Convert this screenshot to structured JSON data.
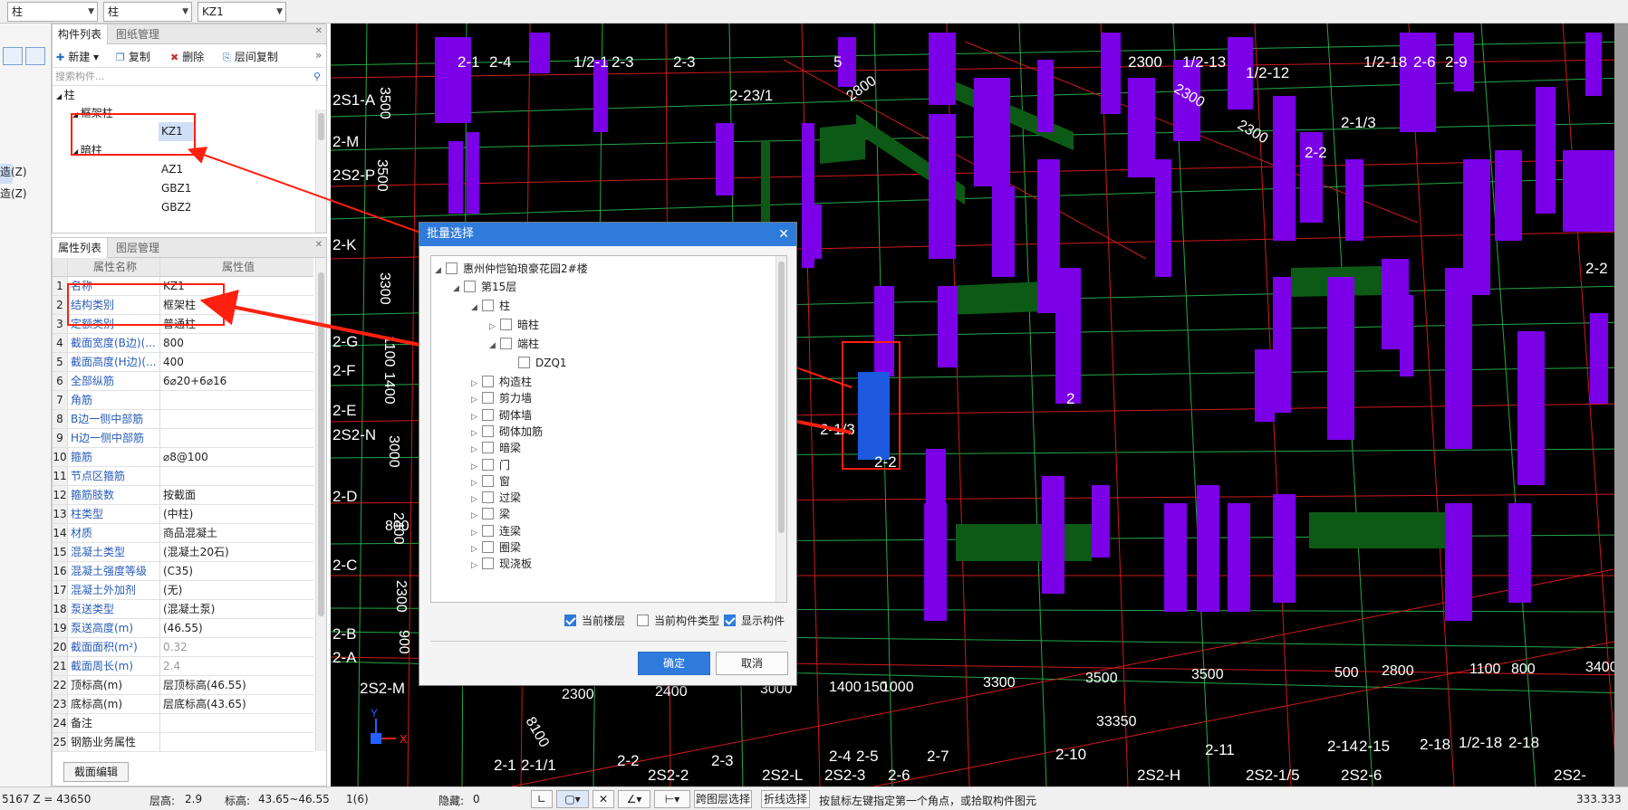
{
  "combos": {
    "c1": "柱",
    "c2": "柱",
    "c3": "KZ1"
  },
  "left_strip": {
    "items": [
      "造(Z)",
      "造(Z)"
    ]
  },
  "component_panel": {
    "tabs": [
      "构件列表",
      "图纸管理"
    ],
    "toolbar": {
      "new": "新建",
      "copy": "复制",
      "delete": "删除",
      "floor_copy": "层间复制"
    },
    "search_placeholder": "搜索构件...",
    "tree": {
      "root": "柱",
      "frame_col": "框架柱",
      "kz1": "KZ1",
      "hidden_col": "暗柱",
      "az1": "AZ1",
      "gbz1": "GBZ1",
      "gbz2": "GBZ2"
    }
  },
  "property_panel": {
    "tabs": [
      "属性列表",
      "图层管理"
    ],
    "headers": {
      "name": "属性名称",
      "value": "属性值"
    },
    "rows": [
      {
        "n": "1",
        "name": "名称",
        "value": "KZ1"
      },
      {
        "n": "2",
        "name": "结构类别",
        "value": "框架柱"
      },
      {
        "n": "3",
        "name": "定额类别",
        "value": "普通柱"
      },
      {
        "n": "4",
        "name": "截面宽度(B边)(...",
        "value": "800"
      },
      {
        "n": "5",
        "name": "截面高度(H边)(...",
        "value": "400"
      },
      {
        "n": "6",
        "name": "全部纵筋",
        "value": "6⌀20+6⌀16"
      },
      {
        "n": "7",
        "name": "角筋",
        "value": ""
      },
      {
        "n": "8",
        "name": "B边一侧中部筋",
        "value": ""
      },
      {
        "n": "9",
        "name": "H边一侧中部筋",
        "value": ""
      },
      {
        "n": "10",
        "name": "箍筋",
        "value": "⌀8@100"
      },
      {
        "n": "11",
        "name": "节点区箍筋",
        "value": ""
      },
      {
        "n": "12",
        "name": "箍筋肢数",
        "value": "按截面"
      },
      {
        "n": "13",
        "name": "柱类型",
        "value": "(中柱)"
      },
      {
        "n": "14",
        "name": "材质",
        "value": "商品混凝土"
      },
      {
        "n": "15",
        "name": "混凝土类型",
        "value": "(混凝土20石)"
      },
      {
        "n": "16",
        "name": "混凝土强度等级",
        "value": "(C35)"
      },
      {
        "n": "17",
        "name": "混凝土外加剂",
        "value": "(无)"
      },
      {
        "n": "18",
        "name": "泵送类型",
        "value": "(混凝土泵)"
      },
      {
        "n": "19",
        "name": "泵送高度(m)",
        "value": "(46.55)"
      },
      {
        "n": "20",
        "name": "截面面积(m²)",
        "value": "0.32"
      },
      {
        "n": "21",
        "name": "截面周长(m)",
        "value": "2.4"
      },
      {
        "n": "22",
        "name": "顶标高(m)",
        "value": "层顶标高(46.55)"
      },
      {
        "n": "23",
        "name": "底标高(m)",
        "value": "层底标高(43.65)"
      },
      {
        "n": "24",
        "name": "备注",
        "value": ""
      },
      {
        "n": "25",
        "name": "钢筋业务属性",
        "value": ""
      }
    ],
    "edit_button": "截面编辑"
  },
  "dialog": {
    "title": "批量选择",
    "tree": {
      "root": "惠州仲恺铂琅豪花园2#楼",
      "floor": "第15层",
      "col": "柱",
      "hidden": "暗柱",
      "end": "端柱",
      "dzq1": "DZQ1",
      "cats": [
        "构造柱",
        "剪力墙",
        "砌体墙",
        "砌体加筋",
        "暗梁",
        "门",
        "窗",
        "过梁",
        "梁",
        "连梁",
        "圈梁",
        "现浇板"
      ]
    },
    "options": {
      "current_floor": "当前楼层",
      "current_type": "当前构件类型",
      "show": "显示构件"
    },
    "ok": "确定",
    "cancel": "取消"
  },
  "viewport": {
    "labels_top": [
      "2-1",
      "2-4",
      "1/2-1",
      "2-3",
      "2-3",
      "2-23/1",
      "5",
      "2300",
      "1/2-13",
      "1/2-12",
      "1/2-18",
      "2-9",
      "2-2",
      "2-1/3",
      "2-6"
    ],
    "labels_left": [
      "2S1-A",
      "2-M",
      "2S2-P",
      "2-K",
      "2-G",
      "2-F",
      "2-E",
      "2S2-N",
      "2-D",
      "2-C",
      "2-B",
      "2-A",
      "2S2-M"
    ],
    "labels_bottom": [
      "2-1",
      "2-1/1",
      "2-2",
      "2S2-2",
      "2-3",
      "2S2-L",
      "2S2-3",
      "2-4",
      "2-5",
      "2-6",
      "2-7",
      "2-10",
      "2S2-H",
      "2-11",
      "2S2-1/5",
      "2-14",
      "2-15",
      "2S2-6",
      "2-18",
      "1/2-18",
      "2-18",
      "2S2-"
    ],
    "dims": [
      "3500",
      "3500",
      "3300",
      "1100",
      "1400",
      "3000",
      "2400",
      "2300",
      "900",
      "800",
      "2300",
      "2400",
      "3000",
      "1400",
      "150",
      "1000",
      "3300",
      "3500",
      "3500",
      "500",
      "2800",
      "1100",
      "800",
      "3400",
      "33350",
      "8100",
      "2800",
      "2300",
      "2300"
    ],
    "mid_labels": [
      "2-1/3",
      "2-2",
      "2-2",
      "2"
    ],
    "axis": {
      "y": "Y",
      "x": "X"
    },
    "colors": {
      "column": "#7b00e8",
      "beam": "#0d5a16",
      "selected": "#1e5ae0",
      "grid_green": "#24a848",
      "grid_red": "#d01a1a",
      "highlight": "#ff2010"
    }
  },
  "status": {
    "coord": "5167 Z = 43650",
    "floor_h_label": "层高:",
    "floor_h": "2.9",
    "elev_label": "标高:",
    "elev": "43.65~46.55",
    "count": "1(6)",
    "hidden_label": "隐藏:",
    "hidden": "0",
    "cross_select": "跨图层选择",
    "polyline_select": "折线选择",
    "hint": "按鼠标左键指定第一个角点，或拾取构件图元",
    "right": "333.333"
  }
}
